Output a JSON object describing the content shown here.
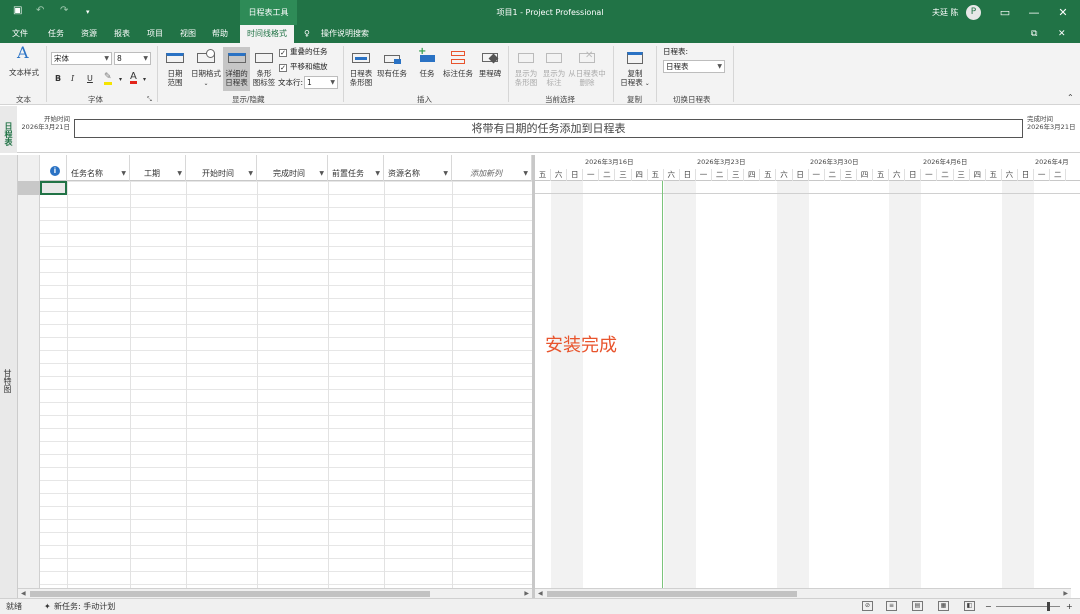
{
  "titlebar": {
    "context_tab": "日程表工具",
    "title": "项目1  -  Project Professional",
    "user": "夫廷 陈",
    "avatar": "P"
  },
  "menu": {
    "file": "文件",
    "task": "任务",
    "resource": "资源",
    "report": "报表",
    "project": "项目",
    "view": "视图",
    "help": "帮助",
    "timeline_format": "时间线格式",
    "tell_me": "操作说明搜索"
  },
  "ribbon": {
    "text_styles": "文本样式",
    "text_group": "文本",
    "font_name": "宋体",
    "font_size": "8",
    "bold": "B",
    "italic": "I",
    "underline": "U",
    "font_group": "字体",
    "date_range": "日期\n范围",
    "date_format": "日期格式",
    "detailed_timeline": "详细的\n日程表",
    "bar_labels": "条形\n图标签",
    "overlap_tasks": "重叠的任务",
    "pan_zoom": "平移和缩放",
    "text_lines_label": "文本行:",
    "text_lines_value": "1",
    "show_hide_group": "显示/隐藏",
    "timeline_bar": "日程表\n条形图",
    "existing_tasks": "现有任务",
    "task": "任务",
    "callout_task": "标注任务",
    "milestone": "里程碑",
    "insert_group": "插入",
    "display_as_bar": "显示为\n条形图",
    "display_as_callout": "显示为\n标注",
    "remove_from_timeline": "从日程表中\n删除",
    "current_selection_group": "当前选择",
    "copy_timeline": "复制\n日程表",
    "copy_group": "复制",
    "timeline_label": "日程表:",
    "timeline_value": "日程表",
    "switch_timeline_group": "切换日程表"
  },
  "timeline": {
    "side_label": "日程表",
    "start_label": "开始时间",
    "start_date": "2026年3月21日",
    "finish_label": "完成时间",
    "finish_date": "2026年3月21日",
    "placeholder": "将带有日期的任务添加到日程表"
  },
  "grid": {
    "columns": [
      "任务名称",
      "工期",
      "开始时间",
      "完成时间",
      "前置任务",
      "资源名称",
      "添加新列"
    ],
    "info_icon": "i"
  },
  "gantt": {
    "side_label": "甘特图",
    "weeks": [
      "2026年3月16日",
      "2026年3月23日",
      "2026年3月30日",
      "2026年4月6日",
      "2026年4月"
    ],
    "days": [
      "五",
      "六",
      "日",
      "一",
      "二",
      "三",
      "四",
      "五",
      "六",
      "日",
      "一",
      "二",
      "三",
      "四",
      "五",
      "六",
      "日",
      "一",
      "二",
      "三",
      "四",
      "五",
      "六",
      "日",
      "一",
      "二",
      "三",
      "四",
      "五",
      "六",
      "日",
      "一",
      "二"
    ],
    "annotation": "安装完成"
  },
  "status": {
    "ready": "就绪",
    "new_task": "新任务: 手动计划"
  },
  "colors": {
    "accent": "#217346",
    "annotation": "#e8542d",
    "today_line": "#7cc47c"
  }
}
